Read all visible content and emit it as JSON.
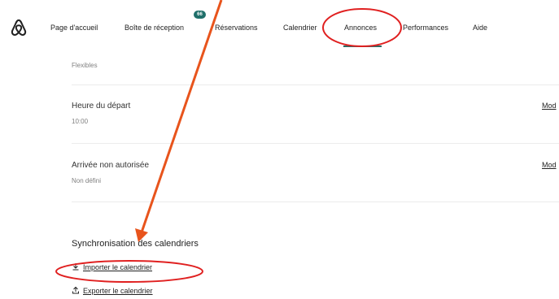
{
  "nav": {
    "logo_icon": "airbnb-logo-icon",
    "items": [
      {
        "label": "Page d'accueil"
      },
      {
        "label": "Boîte de réception"
      },
      {
        "label": "Réservations"
      },
      {
        "label": "Calendrier"
      },
      {
        "label": "Annonces"
      },
      {
        "label": "Performances"
      },
      {
        "label": "Aide"
      }
    ],
    "inbox_badge": "66",
    "active_item": "Annonces",
    "accent_color": "#2c6b66"
  },
  "rows": [
    {
      "value": "Flexibles"
    },
    {
      "label": "Heure du départ",
      "value": "10:00",
      "action": "Mod"
    },
    {
      "label": "Arrivée non autorisée",
      "value": "Non défini",
      "action": "Mod"
    }
  ],
  "sync": {
    "title": "Synchronisation des calendriers",
    "import_label": "Importer le calendrier",
    "import_icon": "download-icon",
    "export_label": "Exporter le calendrier",
    "export_icon": "upload-icon"
  },
  "annotations": {
    "color": "#e8541c",
    "circle_color": "#e02020"
  }
}
